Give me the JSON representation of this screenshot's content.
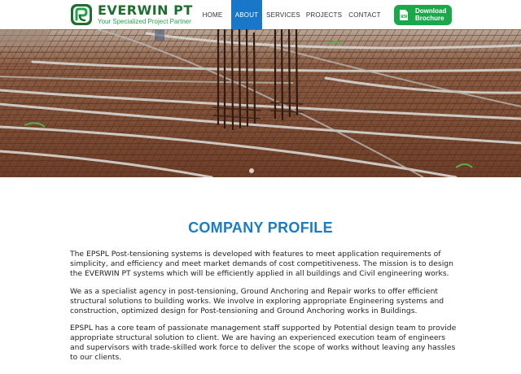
{
  "brand": {
    "name": "EVERWIN PT",
    "tagline": "Your Specialized Project Partner",
    "primary_color": "#1f6e2f",
    "accent_green": "#1aa84a"
  },
  "nav": {
    "items": [
      {
        "label": "HOME"
      },
      {
        "label": "ABOUT"
      },
      {
        "label": "SERVICES"
      },
      {
        "label": "PROJECTS"
      },
      {
        "label": "CONTACT"
      }
    ],
    "active_index": 1,
    "active_color": "#1877c9"
  },
  "brochure": {
    "icon": "pdf-icon",
    "label": "Download Brochure"
  },
  "hero": {
    "image": "steel-reinforcement-mesh-construction-site",
    "carousel_active": 0
  },
  "profile": {
    "title": "COMPANY PROFILE",
    "title_color": "#1a7cc4",
    "paragraphs": [
      "The EPSPL Post-tensioning systems is developed with features to meet application requirements of simplicity, and efficiency and meet market demands of cost competitiveness. The mission is to design the EVERWIN PT systems which will be efficiently applied in all buildings and Civil engineering works.",
      "We as a specialist agency in post-tensioning, Ground Anchoring and Repair works to offer efficient structural solutions to building works. We involve in exploring appropriate Engineering systems and construction, optimized design for Post-tensioning and Ground Anchoring works in Buildings.",
      "EPSPL has a core team of passionate management staff supported by Potential design team to provide appropriate structural solution to client. We are having an experienced execution team of engineers and supervisors with trade-skilled work force to deliver the scope of works without leaving any hassles to our clients."
    ]
  }
}
